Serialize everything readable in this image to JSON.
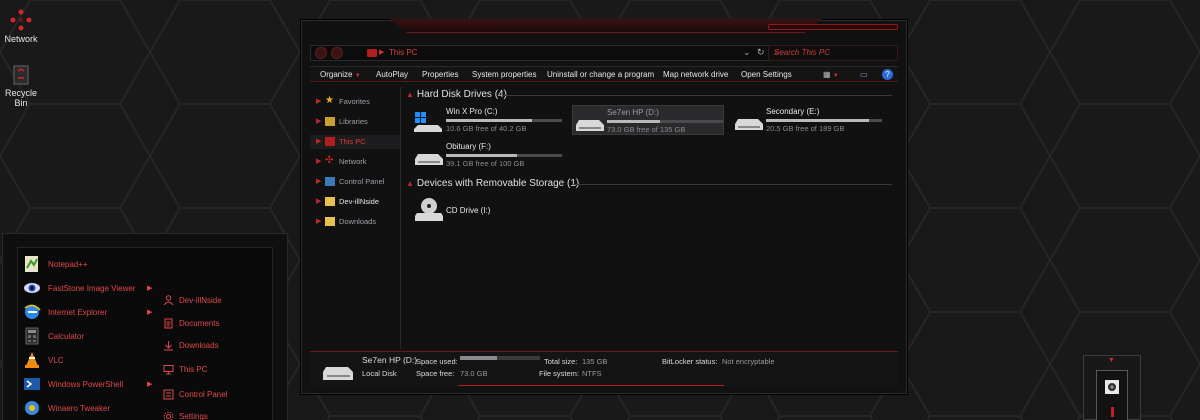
{
  "desktop": {
    "icons": [
      {
        "label": "Network",
        "icon": "network-icon"
      },
      {
        "label": "Recycle Bin",
        "icon": "recycle-bin-icon"
      }
    ]
  },
  "explorer": {
    "address": {
      "location": "This PC",
      "search_placeholder": "Search This PC"
    },
    "toolbar": [
      "Organize",
      "AutoPlay",
      "Properties",
      "System properties",
      "Uninstall or change a program",
      "Map network drive",
      "Open Settings"
    ],
    "nav": [
      {
        "label": "Favorites",
        "icon": "star-icon"
      },
      {
        "label": "Libraries",
        "icon": "library-icon"
      },
      {
        "label": "This PC",
        "icon": "computer-icon",
        "selected": true
      },
      {
        "label": "Network",
        "icon": "network-icon"
      },
      {
        "label": "Control Panel",
        "icon": "control-panel-icon"
      },
      {
        "label": "Dev-illNside",
        "icon": "folder-icon",
        "highlight": true
      },
      {
        "label": "Downloads",
        "icon": "folder-icon"
      }
    ],
    "groups": [
      {
        "title": "Hard Disk Drives (4)"
      },
      {
        "title": "Devices with Removable Storage (1)"
      }
    ],
    "drives": [
      {
        "name": "Win X Pro (C:)",
        "free": "10.6 GB free of 40.2 GB",
        "used_fraction": 0.74,
        "icon": "windows-drive-icon"
      },
      {
        "name": "Se7en HP (D:)",
        "free": "73.0 GB free of 135 GB",
        "used_fraction": 0.46,
        "icon": "hard-drive-icon",
        "selected": true
      },
      {
        "name": "Secondary (E:)",
        "free": "20.5 GB free of 189 GB",
        "used_fraction": 0.89,
        "icon": "hard-drive-icon"
      },
      {
        "name": "Obituary (F:)",
        "free": "39.1 GB free of 100 GB",
        "used_fraction": 0.61,
        "icon": "hard-drive-icon"
      }
    ],
    "removable": [
      {
        "name": "CD Drive (I:)",
        "icon": "cd-drive-icon"
      }
    ],
    "details": {
      "name": "Se7en HP (D:)",
      "type": "Local Disk",
      "space_used_label": "Space used:",
      "space_free_label": "Space free:",
      "space_free": "73.0 GB",
      "total_size_label": "Total size:",
      "total_size": "135 GB",
      "file_system_label": "File system:",
      "file_system": "NTFS",
      "bitlocker_label": "BitLocker status:",
      "bitlocker": "Not encryptable"
    }
  },
  "start_menu": {
    "programs": [
      {
        "label": "Notepad++",
        "icon": "notepad-plus-icon",
        "arrow": false
      },
      {
        "label": "FastStone Image Viewer",
        "icon": "faststone-eye-icon",
        "arrow": true
      },
      {
        "label": "Internet Explorer",
        "icon": "internet-explorer-icon",
        "arrow": true
      },
      {
        "label": "Calculator",
        "icon": "calculator-icon",
        "arrow": false
      },
      {
        "label": "VLC",
        "icon": "vlc-cone-icon",
        "arrow": false
      },
      {
        "label": "Windows PowerShell",
        "icon": "powershell-icon",
        "arrow": true
      },
      {
        "label": "Winaero Tweaker",
        "icon": "winaero-tweaker-icon",
        "arrow": false
      }
    ],
    "places": [
      {
        "label": "Dev-illNside",
        "icon": "user-folder-icon"
      },
      {
        "label": "Documents",
        "icon": "documents-icon"
      },
      {
        "label": "Downloads",
        "icon": "downloads-icon"
      },
      {
        "label": "This PC",
        "icon": "computer-icon"
      },
      {
        "label": "Control Panel",
        "icon": "control-panel-icon"
      },
      {
        "label": "Settings",
        "icon": "gear-icon"
      }
    ]
  },
  "colors": {
    "accent": "#d83a3a",
    "bg": "#1a1a1b"
  }
}
